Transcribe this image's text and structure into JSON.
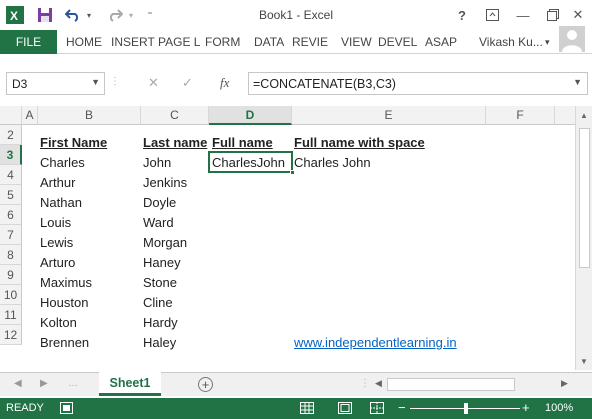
{
  "window": {
    "title": "Book1 - Excel",
    "help": "?",
    "minimize": "—",
    "close": "✕"
  },
  "ribbon": {
    "file": "FILE",
    "tabs": [
      "HOME",
      "INSERT",
      "PAGE L",
      "FORM",
      "DATA",
      "REVIE",
      "VIEW",
      "DEVEL",
      "ASAP"
    ],
    "user": "Vikash Ku...",
    "user_dd": "▾"
  },
  "formula_bar": {
    "name_box": "D3",
    "fx_label": "fx",
    "formula": "=CONCATENATE(B3,C3)"
  },
  "sheet": {
    "columns": [
      "A",
      "B",
      "C",
      "D",
      "E",
      "F"
    ],
    "active_column": "D",
    "rows": [
      "2",
      "3",
      "4",
      "5",
      "6",
      "7",
      "8",
      "9",
      "10",
      "11",
      "12"
    ],
    "active_row": "3",
    "headers": {
      "first_name": "First Name",
      "last_name": "Last name",
      "full_name": "Full name",
      "full_name_space": "Full name with space"
    },
    "first_names": [
      "Charles",
      "Arthur",
      "Nathan",
      "Louis",
      "Lewis",
      "Arturo",
      "Maximus",
      "Houston",
      "Kolton",
      "Brennen"
    ],
    "last_names": [
      "John",
      "Jenkins",
      "Doyle",
      "Ward",
      "Morgan",
      "Haney",
      "Stone",
      "Cline",
      "Hardy",
      "Haley"
    ],
    "d3": "CharlesJohn",
    "e3": "Charles John",
    "link": "www.independentlearning.in"
  },
  "sheet_tabs": {
    "active": "Sheet1",
    "add": "+"
  },
  "status_bar": {
    "status": "READY",
    "zoom": "100%"
  },
  "colors": {
    "accent": "#217346",
    "link": "#0563c1"
  }
}
